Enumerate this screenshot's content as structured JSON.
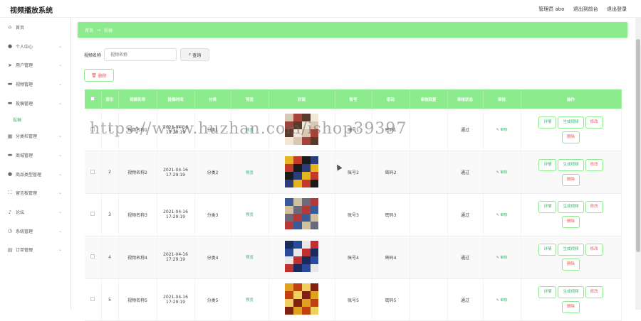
{
  "header": {
    "title": "视频播放系统",
    "admin": "管理员 abo",
    "back_front": "退出到前台",
    "logout": "退出登录"
  },
  "sidebar": {
    "items": [
      {
        "label": "首页",
        "icon": "home-icon",
        "glyph": "⌂",
        "has_chevron": false
      },
      {
        "label": "个人中心",
        "icon": "user-icon",
        "glyph": "●",
        "has_chevron": true
      },
      {
        "label": "用户管理",
        "icon": "send-icon",
        "glyph": "➤",
        "has_chevron": true
      },
      {
        "label": "视频管理",
        "icon": "monitor-icon",
        "glyph": "▬",
        "has_chevron": true
      },
      {
        "label": "投稿管理",
        "icon": "monitor-icon",
        "glyph": "▬",
        "has_chevron": true
      },
      {
        "label": "分类栏管理",
        "icon": "grid-icon",
        "glyph": "▦",
        "has_chevron": true
      },
      {
        "label": "商城管理",
        "icon": "monitor-icon",
        "glyph": "▬",
        "has_chevron": true
      },
      {
        "label": "商品类型管理",
        "icon": "user-icon",
        "glyph": "●",
        "has_chevron": true
      },
      {
        "label": "留言板管理",
        "icon": "expand-icon",
        "glyph": "⛶",
        "has_chevron": true
      },
      {
        "label": "论坛",
        "icon": "mic-icon",
        "glyph": "♪",
        "has_chevron": true
      },
      {
        "label": "系统管理",
        "icon": "clock-icon",
        "glyph": "◷",
        "has_chevron": true
      },
      {
        "label": "订单管理",
        "icon": "doc-icon",
        "glyph": "▤",
        "has_chevron": true
      }
    ],
    "sub_item": "投稿"
  },
  "breadcrumb": {
    "home": "首页",
    "sep": "→",
    "current": "投稿"
  },
  "search": {
    "label": "视频名称",
    "placeholder": "视频名称",
    "button": "查询"
  },
  "delete_button": "删除",
  "table": {
    "headers": [
      "",
      "索引",
      "视频名称",
      "投稿时间",
      "分类",
      "预览",
      "封面",
      "账号",
      "密码",
      "审核回复",
      "审核状态",
      "审核",
      "操作"
    ],
    "rows": [
      {
        "index": "1",
        "name": "视频名称1",
        "date": "2021-04-16",
        "time": "17:29:19",
        "category": "分类1",
        "preview": "预览",
        "cover": "cover-1",
        "account": "账号1",
        "password": "密码1",
        "reply": "",
        "status": "通过",
        "audit": "审核"
      },
      {
        "index": "2",
        "name": "视频名称2",
        "date": "2021-04-16",
        "time": "17:29:19",
        "category": "分类2",
        "preview": "预览",
        "cover": "cover-2",
        "account": "账号2",
        "password": "密码2",
        "reply": "",
        "status": "通过",
        "audit": "审核"
      },
      {
        "index": "3",
        "name": "视频名称3",
        "date": "2021-04-16",
        "time": "17:29:19",
        "category": "分类3",
        "preview": "预览",
        "cover": "cover-3",
        "account": "账号3",
        "password": "密码3",
        "reply": "",
        "status": "通过",
        "audit": "审核"
      },
      {
        "index": "4",
        "name": "视频名称4",
        "date": "2021-04-16",
        "time": "17:29:19",
        "category": "分类4",
        "preview": "预览",
        "cover": "cover-4",
        "account": "账号4",
        "password": "密码4",
        "reply": "",
        "status": "通过",
        "audit": "审核"
      },
      {
        "index": "5",
        "name": "视频名称5",
        "date": "2021-04-16",
        "time": "17:29:19",
        "category": "分类5",
        "preview": "预览",
        "cover": "cover-5",
        "account": "账号5",
        "password": "密码5",
        "reply": "",
        "status": "通过",
        "audit": "审核"
      }
    ],
    "actions": {
      "detail": "详情",
      "generate": "生成视频",
      "edit": "修改",
      "delete": "删除"
    }
  },
  "watermark": "https://www.huzhan.com/ishop39397",
  "colors": {
    "accent": "#8ceb8c",
    "link": "#3cb371",
    "danger": "#e06060"
  }
}
